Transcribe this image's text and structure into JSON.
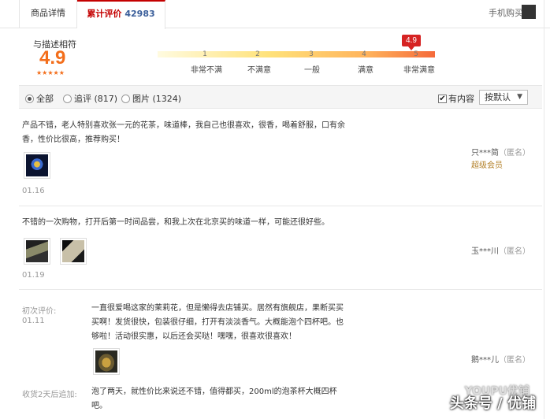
{
  "tabs": {
    "detail_label": "商品详情",
    "reviews_label": "累计评价",
    "reviews_count": "42983",
    "mobile_buy": "手机购买"
  },
  "summary": {
    "match_label": "与描述相符",
    "score": "4.9",
    "stars": "★★★★★",
    "marker_value": "4.9",
    "scale": [
      {
        "num": "1",
        "label": "非常不满"
      },
      {
        "num": "2",
        "label": "不满意"
      },
      {
        "num": "3",
        "label": "一般"
      },
      {
        "num": "4",
        "label": "满意"
      },
      {
        "num": "5",
        "label": "非常满意"
      }
    ]
  },
  "filters": {
    "all": "全部",
    "followup": "追评 (817)",
    "pictures": "图片 (1324)",
    "has_content": "有内容",
    "sort_label": "按默认",
    "sort_caret": "▼",
    "check_mark": "✔"
  },
  "reviews": [
    {
      "text_line1": "产品不错，老人特别喜欢张一元的花茶，味道棒，我自己也很喜欢，很香，喝着舒服，口有余",
      "text_line2": "香，性价比很高，推荐购买！",
      "date": "01.16",
      "user": "只***简",
      "anon": "（匿名）",
      "vip": "超级会员"
    },
    {
      "text_line1": "不错的一次购物，打开后第一时间品尝，和我上次在北京买的味道一样，可能还很好些。",
      "date": "01.19",
      "user": "玉***川",
      "anon": "（匿名）"
    },
    {
      "first_label": "初次评价:",
      "date": "01.11",
      "text_line1": "一直很爱喝这家的茉莉花，但是懒得去店铺买。居然有旗舰店，果断买买",
      "text_line2": "买啊！发货很快，包装很仔细，打开有淡淡香气。大概能泡个四杯吧。也",
      "text_line3": "够啦！活动很实惠，以后还会买哒！嘿嘿，很喜欢很喜欢！",
      "user": "鹅***儿",
      "anon": "（匿名）",
      "append_label": "收货2天后追加:",
      "append_line1": "泡了两天，就性价比来说还不错，值得都买，200ml的泡茶杯大概四杯",
      "append_line2": "吧。"
    }
  ],
  "watermark": {
    "top": "YOUPU优铺",
    "bottom": "头条号 / 优铺"
  }
}
